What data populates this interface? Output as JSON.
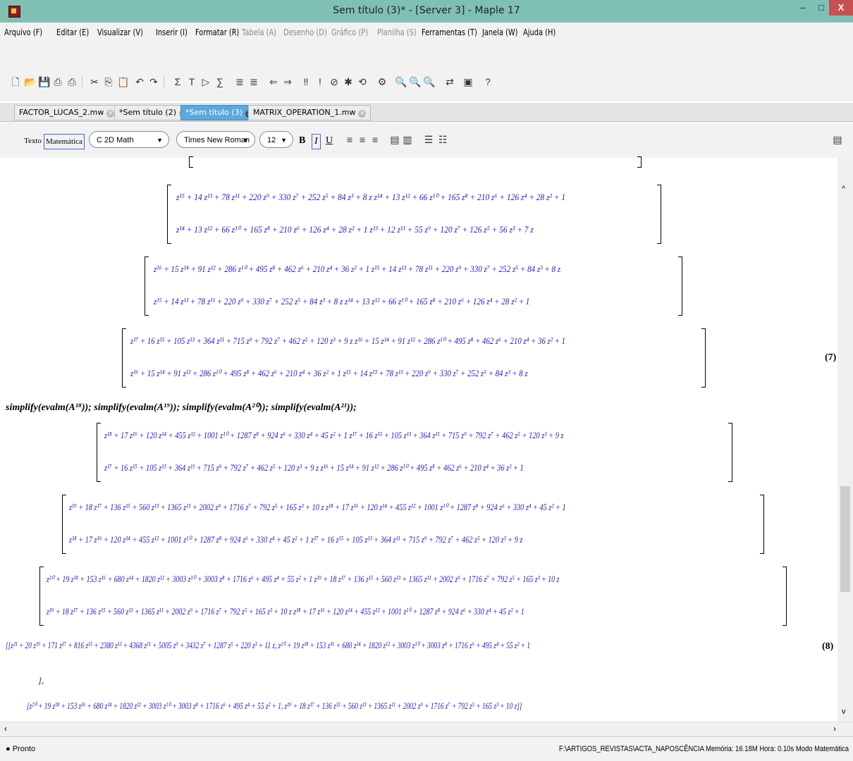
{
  "window": {
    "title": "Sem título (3)* - [Server 3] - Maple 17",
    "close_label": "X",
    "min_label": "–",
    "max_label": "□"
  },
  "menu": [
    {
      "label": "Arquivo (F)",
      "enabled": true
    },
    {
      "label": "Editar (E)",
      "enabled": true
    },
    {
      "label": "Visualizar (V)",
      "enabled": true
    },
    {
      "label": "Inserir (I)",
      "enabled": true
    },
    {
      "label": "Formatar (R)",
      "enabled": true
    },
    {
      "label": "Tabela (A)",
      "enabled": false
    },
    {
      "label": "Desenho (D)",
      "enabled": false
    },
    {
      "label": "Gráfico (P)",
      "enabled": false
    },
    {
      "label": "Planilha (S)",
      "enabled": false
    },
    {
      "label": "Ferramentas (T)",
      "enabled": true
    },
    {
      "label": "Janela (W)",
      "enabled": true
    },
    {
      "label": "Ajuda (H)",
      "enabled": true
    }
  ],
  "tabs": [
    {
      "label": "FACTOR_LUCAS_2.mw",
      "active": false
    },
    {
      "label": "*Sem título (2)",
      "active": false
    },
    {
      "label": "*Sem título (3)",
      "active": true
    },
    {
      "label": "MATRIX_OPERATION_1.mw",
      "active": false
    }
  ],
  "format": {
    "texto": "Texto",
    "matematica": "Matemática",
    "mode": "2D Math",
    "mode_letter": "C",
    "font": "Times New Roman",
    "size": "12",
    "bold": "B",
    "italic": "I",
    "underline": "U"
  },
  "math_lines": [
    "z¹⁵ + 14 z¹³ + 78 z¹¹ + 220 z⁹ + 330 z⁷ + 252 z⁵ + 84 z³ + 8 z   z¹⁴ + 13 z¹² + 66 z¹⁰ + 165 z⁸ + 210 z⁶ + 126 z⁴ + 28 z² + 1",
    "z¹⁴ + 13 z¹² + 66 z¹⁰ + 165 z⁸ + 210 z⁶ + 126 z⁴ + 28 z² + 1        z¹³ + 12 z¹¹ + 55 z⁹ + 120 z⁷ + 126 z⁵ + 56 z³ + 7 z",
    "z¹⁶ + 15 z¹⁴ + 91 z¹² + 286 z¹⁰ + 495 z⁸ + 462 z⁶ + 210 z⁴ + 36 z² + 1   z¹⁵ + 14 z¹³ + 78 z¹¹ + 220 z⁹ + 330 z⁷ + 252 z⁵ + 84 z³ + 8 z",
    "z¹⁵ + 14 z¹³ + 78 z¹¹ + 220 z⁹ + 330 z⁷ + 252 z⁵ + 84 z³ + 8 z        z¹⁴ + 13 z¹² + 66 z¹⁰ + 165 z⁸ + 210 z⁶ + 126 z⁴ + 28 z² + 1",
    "z¹⁷ + 16 z¹⁵ + 105 z¹³ + 364 z¹¹ + 715 z⁹ + 792 z⁷ + 462 z⁵ + 120 z³ + 9 z   z¹⁶ + 15 z¹⁴ + 91 z¹² + 286 z¹⁰ + 495 z⁸ + 462 z⁶ + 210 z⁴ + 36 z² + 1",
    "z¹⁶ + 15 z¹⁴ + 91 z¹² + 286 z¹⁰ + 495 z⁸ + 462 z⁶ + 210 z⁴ + 36 z² + 1        z¹⁵ + 14 z¹³ + 78 z¹¹ + 220 z⁹ + 330 z⁷ + 252 z⁵ + 84 z³ + 8 z",
    "z¹⁸ + 17 z¹⁶ + 120 z¹⁴ + 455 z¹² + 1001 z¹⁰ + 1287 z⁸ + 924 z⁶ + 330 z⁴ + 45 z² + 1   z¹⁷ + 16 z¹⁵ + 105 z¹³ + 364 z¹¹ + 715 z⁹ + 792 z⁷ + 462 z⁵ + 120 z³ + 9 z",
    "z¹⁷ + 16 z¹⁵ + 105 z¹³ + 364 z¹¹ + 715 z⁹ + 792 z⁷ + 462 z⁵ + 120 z³ + 9 z        z¹⁶ + 15 z¹⁴ + 91 z¹² + 286 z¹⁰ + 495 z⁸ + 462 z⁶ + 210 z⁴ + 36 z² + 1",
    "z¹⁹ + 18 z¹⁷ + 136 z¹⁵ + 560 z¹³ + 1365 z¹¹ + 2002 z⁹ + 1716 z⁷ + 792 z⁵ + 165 z³ + 10 z   z¹⁸ + 17 z¹⁶ + 120 z¹⁴ + 455 z¹² + 1001 z¹⁰ + 1287 z⁸ + 924 z⁶ + 330 z⁴ + 45 z² + 1",
    "z¹⁸ + 17 z¹⁶ + 120 z¹⁴ + 455 z¹² + 1001 z¹⁰ + 1287 z⁸ + 924 z⁶ + 330 z⁴ + 45 z² + 1        z¹⁷ + 16 z¹⁵ + 105 z¹³ + 364 z¹¹ + 715 z⁹ + 792 z⁷ + 462 z⁵ + 120 z³ + 9 z",
    "z²⁰ + 19 z¹⁸ + 153 z¹⁶ + 680 z¹⁴ + 1820 z¹² + 3003 z¹⁰ + 3003 z⁸ + 1716 z⁶ + 495 z⁴ + 55 z² + 1   z¹⁹ + 18 z¹⁷ + 136 z¹⁵ + 560 z¹³ + 1365 z¹¹ + 2002 z⁹ + 1716 z⁷ + 792 z⁵ + 165 z³ + 10 z",
    "z¹⁹ + 18 z¹⁷ + 136 z¹⁵ + 560 z¹³ + 1365 z¹¹ + 2002 z⁹ + 1716 z⁷ + 792 z⁵ + 165 z³ + 10 z        z¹⁸ + 17 z¹⁶ + 120 z¹⁴ + 455 z¹² + 1001 z¹⁰ + 1287 z⁸ + 924 z⁶ + 330 z⁴ + 45 z² + 1",
    "[[z²¹ + 20 z¹⁹ + 171 z¹⁷ + 816 z¹⁵ + 2380 z¹³ + 4368 z¹¹ + 5005 z⁹ + 3432 z⁷ + 1287 z⁵ + 220 z³ + 11 z, z²⁰ + 19 z¹⁸ + 153 z¹⁶ + 680 z¹⁴ + 1820 z¹² + 3003 z¹⁰ + 3003 z⁸ + 1716 z⁶ + 495 z⁴ + 55 z² + 1",
    "],",
    "[z²⁰ + 19 z¹⁸ + 153 z¹⁶ + 680 z¹⁴ + 1820 z¹² + 3003 z¹⁰ + 3003 z⁸ + 1716 z⁶ + 495 z⁴ + 55 z² + 1, z¹⁹ + 18 z¹⁷ + 136 z¹⁵ + 560 z¹³ + 1365 z¹¹ + 2002 z⁹ + 1716 z⁷ + 792 z⁵ + 165 z³ + 10 z]]"
  ],
  "command": "simplify(evalm(A¹⁸)); simplify(evalm(A¹⁹)); simplify(evalm(A²⁰)); simplify(evalm(A²¹));",
  "eq7": "(7)",
  "eq8": "(8)",
  "status": {
    "left": "● Pronto",
    "right": "F:\\ARTIGOS_REVISTAS\\ACTA_NAPOSCÊNCIA   Memória: 16.18M   Hora: 0.10s   Modo Matemática"
  }
}
